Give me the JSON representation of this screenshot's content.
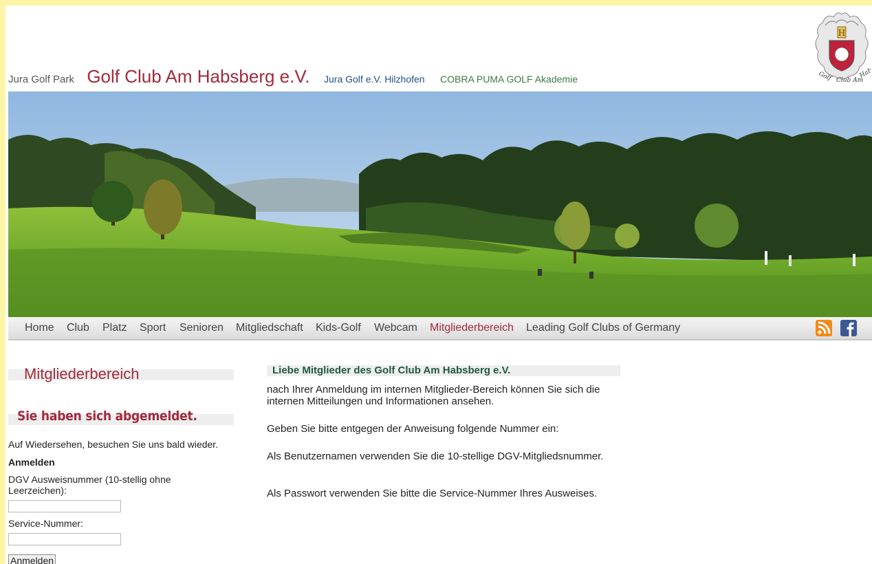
{
  "header": {
    "park": "Jura Golf Park",
    "club": "Golf Club Am Habsberg e.V.",
    "hilzhofen": "Jura Golf e.V. Hilzhofen",
    "akademie": "COBRA PUMA GOLF Akademie"
  },
  "nav": {
    "items": [
      "Home",
      "Club",
      "Platz",
      "Sport",
      "Senioren",
      "Mitgliedschaft",
      "Kids-Golf",
      "Webcam",
      "Mitgliederbereich",
      "Leading Golf Clubs of Germany"
    ],
    "active": "Mitgliederbereich",
    "rss_icon": "rss-icon",
    "facebook_icon": "facebook-icon"
  },
  "sidebar": {
    "title": "Mitgliederbereich",
    "status": "Sie haben sich abgemeldet.",
    "goodbye": "Auf Wiedersehen, besuchen Sie uns bald wieder.",
    "login_heading": "Anmelden",
    "dgv_label": "DGV Ausweisnummer (10-stellig ohne Leerzeichen):",
    "dgv_value": "",
    "service_label": "Service-Nummer:",
    "service_value": "",
    "login_button": "Anmelden"
  },
  "main": {
    "heading": "Liebe Mitglieder des Golf Club Am Habsberg e.V.",
    "p1": "nach Ihrer Anmeldung im internen Mitglieder-Bereich können Sie sich die internen Mitteilungen und Informationen ansehen.",
    "p2": "Geben Sie bitte entgegen der Anweisung folgende Nummer ein:",
    "p3": "Als Benutzernamen verwenden Sie die 10-stellige DGV-Mitgliedsnummer.",
    "p4": "Als Passwort verwenden Sie bitte die Service-Nummer Ihres Ausweises."
  },
  "colors": {
    "frame": "#fdf5a6",
    "brand_red": "#a22a3a",
    "link_blue": "#1f4e86",
    "green": "#3c7a3c"
  }
}
